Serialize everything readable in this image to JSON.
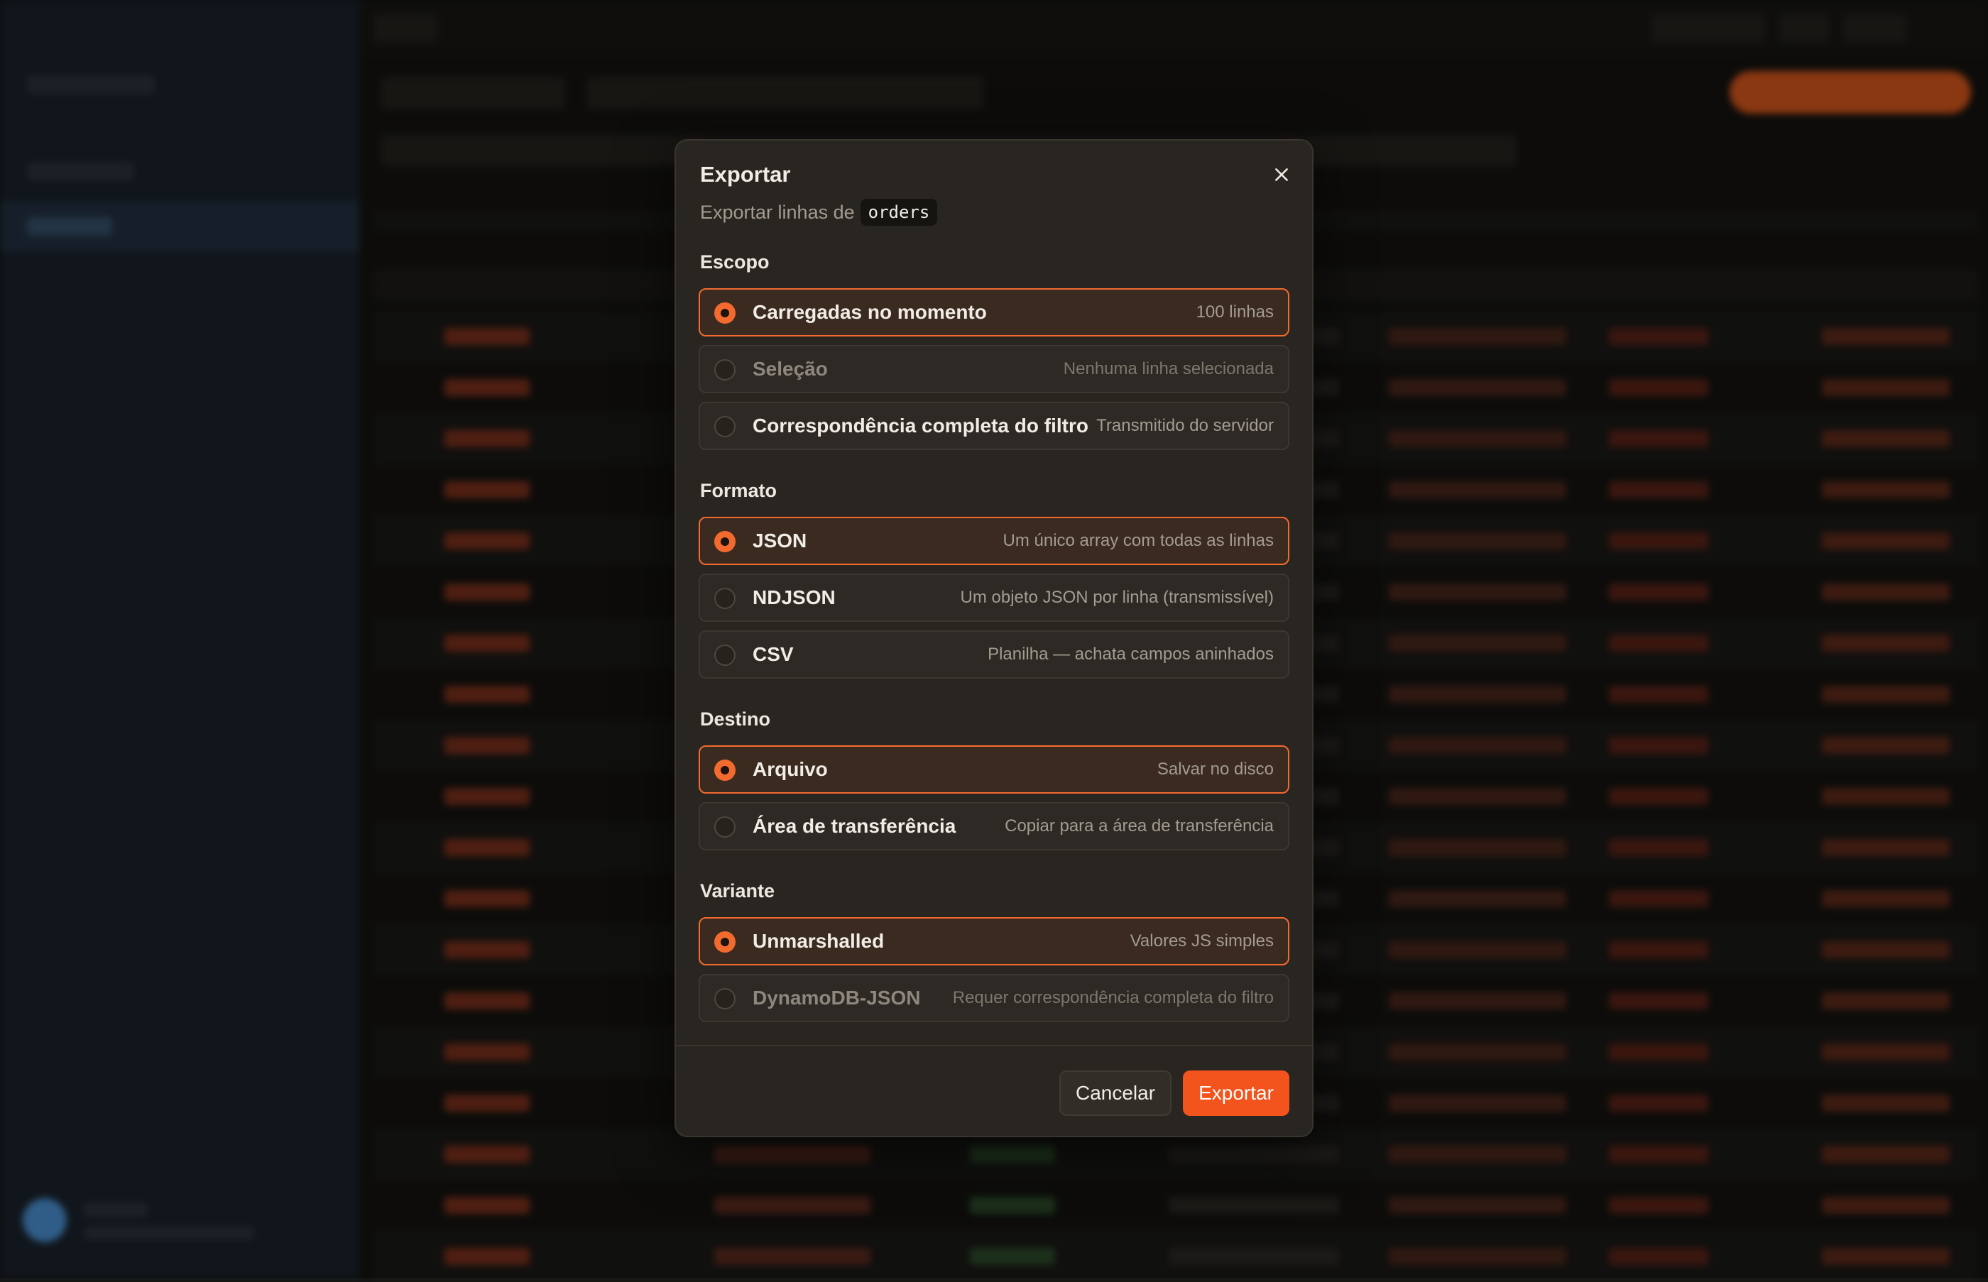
{
  "dialog": {
    "title": "Exportar",
    "subtitle": "Exportar linhas de",
    "table_name": "orders",
    "close_icon": "close-icon",
    "sections": {
      "scope": {
        "label": "Escopo",
        "options": [
          {
            "label": "Carregadas no momento",
            "desc": "100 linhas",
            "selected": true,
            "disabled": false
          },
          {
            "label": "Seleção",
            "desc": "Nenhuma linha selecionada",
            "selected": false,
            "disabled": true
          },
          {
            "label": "Correspondência completa do filtro",
            "desc": "Transmitido do servidor",
            "selected": false,
            "disabled": false
          }
        ]
      },
      "format": {
        "label": "Formato",
        "options": [
          {
            "label": "JSON",
            "desc": "Um único array com todas as linhas",
            "selected": true,
            "disabled": false
          },
          {
            "label": "NDJSON",
            "desc": "Um objeto JSON por linha (transmissível)",
            "selected": false,
            "disabled": false
          },
          {
            "label": "CSV",
            "desc": "Planilha — achata campos aninhados",
            "selected": false,
            "disabled": false
          }
        ]
      },
      "destination": {
        "label": "Destino",
        "options": [
          {
            "label": "Arquivo",
            "desc": "Salvar no disco",
            "selected": true,
            "disabled": false
          },
          {
            "label": "Área de transferência",
            "desc": "Copiar para a área de transferência",
            "selected": false,
            "disabled": false
          }
        ]
      },
      "variant": {
        "label": "Variante",
        "options": [
          {
            "label": "Unmarshalled",
            "desc": "Valores JS simples",
            "selected": true,
            "disabled": false
          },
          {
            "label": "DynamoDB-JSON",
            "desc": "Requer correspondência completa do filtro",
            "selected": false,
            "disabled": true
          }
        ]
      }
    },
    "cancel_label": "Cancelar",
    "export_label": "Exportar"
  },
  "colors": {
    "accent": "#f36a2f",
    "export_button": "#f3531c",
    "modal_bg": "#292520"
  }
}
